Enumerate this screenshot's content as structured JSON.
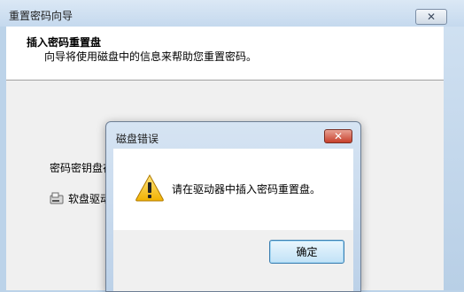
{
  "wizard": {
    "title": "重置密码向导",
    "header_title": "插入密码重置盘",
    "header_subtitle": "向导将使用磁盘中的信息来帮助您重置密码。",
    "drive_label": "密码密钥盘在",
    "drive_value": "软盘驱动器"
  },
  "dialog": {
    "title": "磁盘错误",
    "message": "请在驱动器中插入密码重置盘。",
    "ok_label": "确定"
  },
  "icons": {
    "warning": "warning-icon",
    "close": "close-icon",
    "floppy": "floppy-drive-icon"
  }
}
